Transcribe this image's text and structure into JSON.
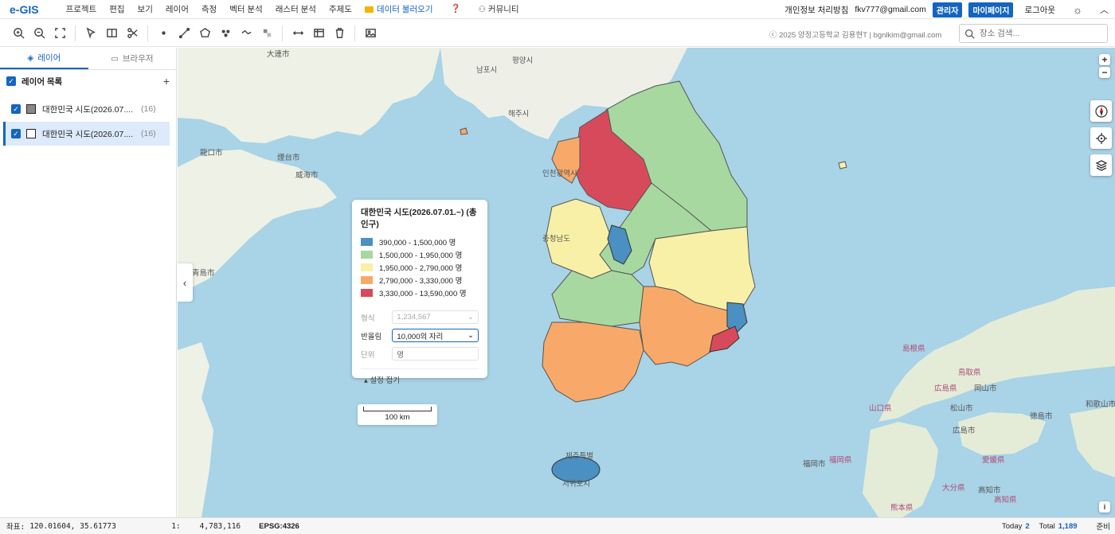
{
  "app": {
    "logo": "e-GIS"
  },
  "menu": [
    "프로젝트",
    "편집",
    "보기",
    "레이어",
    "측정",
    "벡터 분석",
    "래스터 분석",
    "주제도"
  ],
  "menu_extra": {
    "load_data": "데이터 불러오기",
    "help": "❓",
    "community": "커뮤니티"
  },
  "topright": {
    "privacy": "개인정보 처리방침",
    "email": "fkv777@gmail.com",
    "admin": "관리자",
    "mypage": "마이페이지",
    "logout": "로그아웃"
  },
  "toolbar": {
    "credit": "ⓒ 2025 양정고등학교 김용현T | bgnlkim@gmail.com",
    "search_placeholder": "장소 검색..."
  },
  "sidebar": {
    "tabs": [
      {
        "label": "레이어",
        "active": true
      },
      {
        "label": "브라우저",
        "active": false
      }
    ],
    "layer_list_title": "레이어 목록",
    "layers": [
      {
        "name": "대한민국 시도(2026.07....",
        "count": "(16)",
        "swatch": "#888888",
        "selected": false
      },
      {
        "name": "대한민국 시도(2026.07....",
        "count": "(16)",
        "swatch": "#ffffff",
        "selected": true
      }
    ]
  },
  "legend": {
    "title": "대한민국 시도(2026.07.01.~) (총 인구)",
    "classes": [
      {
        "label": "390,000 - 1,500,000 명",
        "color": "#4a90c2"
      },
      {
        "label": "1,500,000 - 1,950,000 명",
        "color": "#a7d8a0"
      },
      {
        "label": "1,950,000 - 2,790,000 명",
        "color": "#f8f0a6"
      },
      {
        "label": "2,790,000 - 3,330,000 명",
        "color": "#f8a96a"
      },
      {
        "label": "3,330,000 - 13,590,000 명",
        "color": "#d64a5c"
      }
    ],
    "format_label": "형식",
    "format_value": "1,234,567",
    "round_label": "반올림",
    "round_value": "10,000의 자리",
    "unit_label": "단위",
    "unit_value": "명",
    "fold": "설정 접기"
  },
  "scale": {
    "label": "100 km"
  },
  "map_labels": [
    {
      "t": "大連市",
      "p": false
    },
    {
      "t": "평양시",
      "p": false
    },
    {
      "t": "남포시",
      "p": false
    },
    {
      "t": "해주시",
      "p": false
    },
    {
      "t": "인천광역시",
      "p": false
    },
    {
      "t": "충청남도",
      "p": false
    },
    {
      "t": "제주특별",
      "p": false
    },
    {
      "t": "서귀포시",
      "p": false
    },
    {
      "t": "煙台市",
      "p": false
    },
    {
      "t": "威海市",
      "p": false
    },
    {
      "t": "青島市",
      "p": false
    },
    {
      "t": "龍口市",
      "p": false
    },
    {
      "t": "広島市",
      "p": false
    },
    {
      "t": "松山市",
      "p": false
    },
    {
      "t": "福岡市",
      "p": false
    },
    {
      "t": "高知市",
      "p": false
    },
    {
      "t": "岡山市",
      "p": false
    },
    {
      "t": "徳島市",
      "p": false
    },
    {
      "t": "和歌山市",
      "p": false
    },
    {
      "t": "鳥取県",
      "p": true
    },
    {
      "t": "島根県",
      "p": true
    },
    {
      "t": "広島県",
      "p": true
    },
    {
      "t": "山口県",
      "p": true
    },
    {
      "t": "福岡県",
      "p": true
    },
    {
      "t": "熊本県",
      "p": true
    },
    {
      "t": "大分県",
      "p": true
    },
    {
      "t": "愛媛県",
      "p": true
    },
    {
      "t": "高知県",
      "p": true
    }
  ],
  "status": {
    "coord_label": "좌표:",
    "coord": "120.01604, 35.61773",
    "scale_prefix": "1:",
    "scale": "4,783,116",
    "crs": "EPSG:4326",
    "today_label": "Today",
    "today": "2",
    "total_label": "Total",
    "total": "1,189",
    "ready": "준비"
  }
}
